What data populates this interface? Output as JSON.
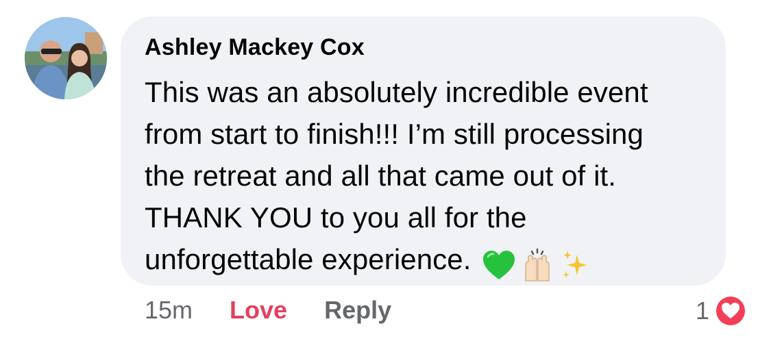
{
  "comment": {
    "author": "Ashley Mackey Cox",
    "lines": [
      "This was an absolutely incredible event",
      "from start to finish!!! I’m still processing",
      "the retreat and all that came out of it.",
      "THANK YOU to you all for the",
      "unforgettable experience."
    ],
    "emojis": [
      "green-heart",
      "raising-hands",
      "sparkles"
    ],
    "time": "15m",
    "love_label": "Love",
    "reply_label": "Reply",
    "reaction_count": "1",
    "reaction_type": "love-heart",
    "colors": {
      "bubble": "#f0f2f5",
      "love": "#e4405f",
      "meta": "#65676b",
      "text": "#050505"
    }
  }
}
